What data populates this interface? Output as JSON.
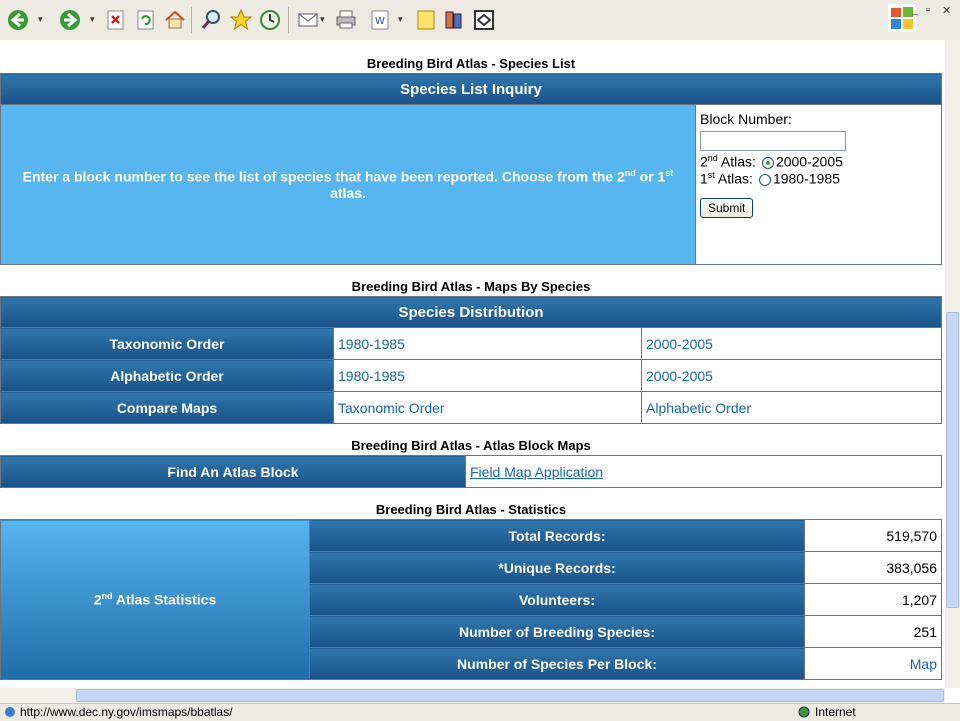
{
  "toolbar": {
    "icons": [
      "back-icon",
      "forward-icon",
      "stop-icon",
      "refresh-icon",
      "home-icon",
      "search-icon",
      "favorites-icon",
      "history-icon",
      "mail-icon",
      "print-icon",
      "edit-icon",
      "notes-icon",
      "research-icon",
      "messenger-icon"
    ]
  },
  "species_list": {
    "title": "Breeding Bird Atlas - Species List",
    "header": "Species List Inquiry",
    "description_part1": "Enter a block number to see the list of species that have been reported. Choose from the 2",
    "description_sup1": "nd",
    "description_part2": " or 1",
    "description_sup2": "st",
    "description_part3": " atlas.",
    "block_label": "Block Number:",
    "block_value": "",
    "atlas2_prefix": "2",
    "atlas2_sup": "nd",
    "atlas2_label": " Atlas:",
    "atlas2_option": "2000-2005",
    "atlas1_prefix": "1",
    "atlas1_sup": "st",
    "atlas1_label": " Atlas:",
    "atlas1_option": "1980-1985",
    "submit_label": "Submit"
  },
  "maps": {
    "title": "Breeding Bird Atlas - Maps By Species",
    "header": "Species Distribution",
    "rows": [
      {
        "label": "Taxonomic Order",
        "link1": "1980-1985",
        "link2": "2000-2005"
      },
      {
        "label": "Alphabetic Order",
        "link1": "1980-1985",
        "link2": "2000-2005"
      },
      {
        "label": "Compare Maps",
        "link1": "Taxonomic Order",
        "link2": "Alphabetic Order"
      }
    ]
  },
  "block_maps": {
    "title": "Breeding Bird Atlas - Atlas Block Maps",
    "label": "Find An Atlas Block",
    "link": "Field Map Application"
  },
  "statistics": {
    "title": "Breeding Bird Atlas - Statistics",
    "side_prefix": "2",
    "side_sup": "nd",
    "side_label": " Atlas Statistics",
    "rows": [
      {
        "label": "Total Records:",
        "value": "519,570"
      },
      {
        "label": "*Unique Records:",
        "value": "383,056"
      },
      {
        "label": "Volunteers:",
        "value": "1,207"
      },
      {
        "label": "Number of Breeding Species:",
        "value": "251"
      },
      {
        "label": "Number of Species Per Block:",
        "value": "Map"
      }
    ]
  },
  "status_bar": {
    "url": "http://www.dec.ny.gov/imsmaps/bbatlas/",
    "zone": "Internet"
  },
  "colors": {
    "header_blue": "#1f5f99",
    "light_blue": "#57b5f0",
    "link": "#1666b4"
  }
}
